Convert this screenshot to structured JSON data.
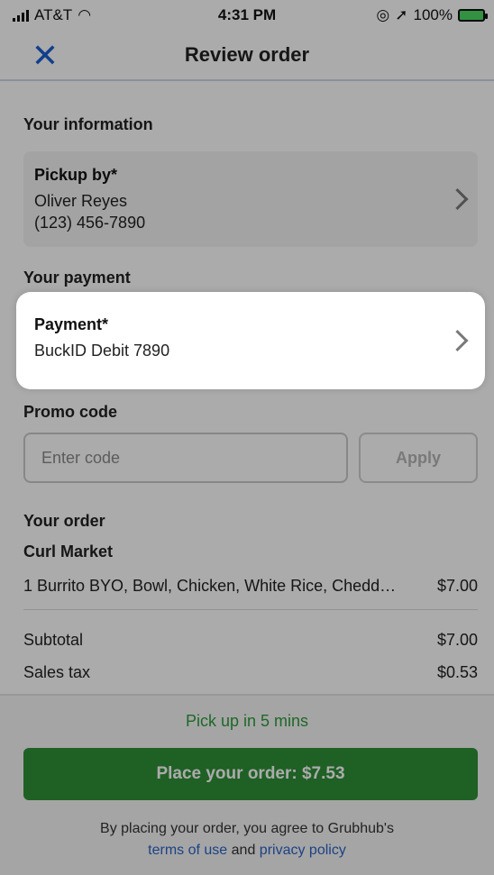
{
  "status_bar": {
    "carrier": "AT&T",
    "time": "4:31 PM",
    "battery": "100%"
  },
  "header": {
    "title": "Review order",
    "close_icon": "close-icon"
  },
  "your_information": {
    "section_title": "Your information",
    "card_title": "Pickup by*",
    "name": "Oliver  Reyes",
    "phone": "(123) 456-7890"
  },
  "your_payment": {
    "section_title": "Your payment",
    "card_title": "Payment*",
    "method": "BuckID Debit 7890"
  },
  "promo": {
    "section_title": "Promo code",
    "placeholder": "Enter code",
    "apply_label": "Apply"
  },
  "order": {
    "section_title": "Your order",
    "restaurant": "Curl Market",
    "items": [
      {
        "desc": "1 Burrito BYO, Bowl, Chicken, White Rice, Chedd…",
        "price": "$7.00"
      }
    ],
    "subtotal_label": "Subtotal",
    "subtotal": "$7.00",
    "tax_label": "Sales tax",
    "tax": "$0.53"
  },
  "footer": {
    "pickup_note": "Pick up in 5 mins",
    "place_order_label": "Place your order: $7.53",
    "legal_prefix": "By placing your order, you agree to Grubhub's",
    "terms_link": "terms of use",
    "and": "and",
    "privacy_link": "privacy policy"
  },
  "colors": {
    "accent_blue": "#1a5fd1",
    "primary_green": "#2f8f38",
    "pickup_green": "#2e9b3b"
  }
}
